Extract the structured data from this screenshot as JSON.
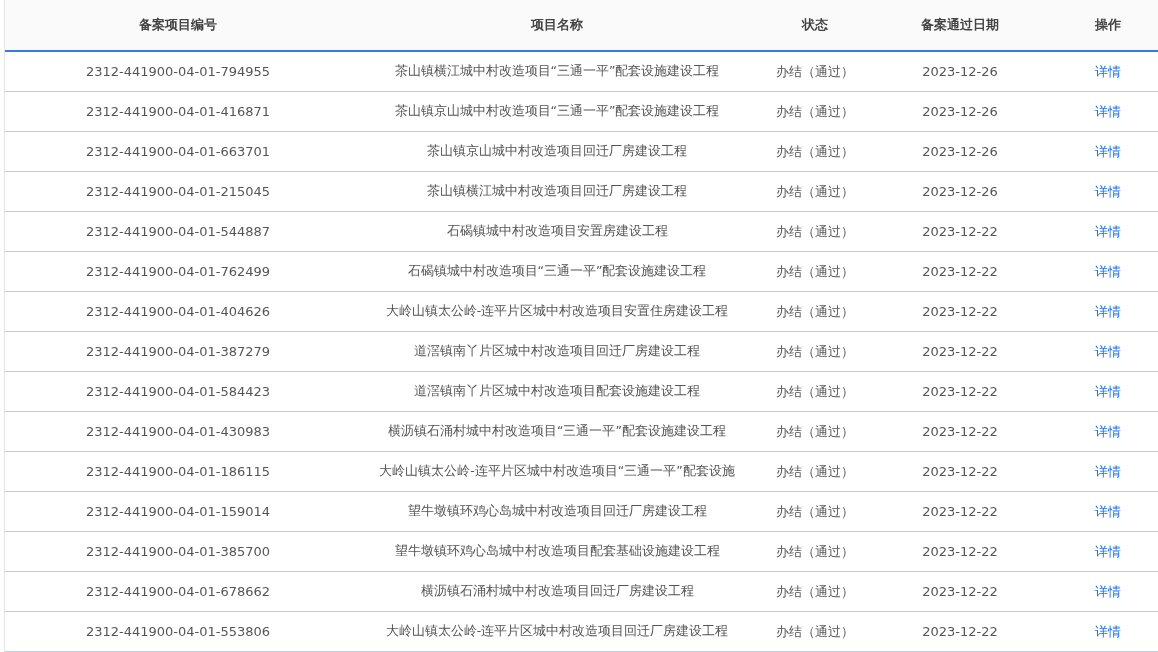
{
  "table": {
    "columns": [
      "备案项目编号",
      "项目名称",
      "状态",
      "备案通过日期",
      "操作"
    ],
    "rows": [
      {
        "code": "2312-441900-04-01-794955",
        "name": "茶山镇横江城中村改造项目“三通一平”配套设施建设工程",
        "status": "办结（通过）",
        "date": "2023-12-26",
        "action": "详情"
      },
      {
        "code": "2312-441900-04-01-416871",
        "name": "茶山镇京山城中村改造项目“三通一平”配套设施建设工程",
        "status": "办结（通过）",
        "date": "2023-12-26",
        "action": "详情"
      },
      {
        "code": "2312-441900-04-01-663701",
        "name": "茶山镇京山城中村改造项目回迁厂房建设工程",
        "status": "办结（通过）",
        "date": "2023-12-26",
        "action": "详情"
      },
      {
        "code": "2312-441900-04-01-215045",
        "name": "茶山镇横江城中村改造项目回迁厂房建设工程",
        "status": "办结（通过）",
        "date": "2023-12-26",
        "action": "详情"
      },
      {
        "code": "2312-441900-04-01-544887",
        "name": "石碣镇城中村改造项目安置房建设工程",
        "status": "办结（通过）",
        "date": "2023-12-22",
        "action": "详情"
      },
      {
        "code": "2312-441900-04-01-762499",
        "name": "石碣镇城中村改造项目“三通一平”配套设施建设工程",
        "status": "办结（通过）",
        "date": "2023-12-22",
        "action": "详情"
      },
      {
        "code": "2312-441900-04-01-404626",
        "name": "大岭山镇太公岭-连平片区城中村改造项目安置住房建设工程",
        "status": "办结（通过）",
        "date": "2023-12-22",
        "action": "详情"
      },
      {
        "code": "2312-441900-04-01-387279",
        "name": "道滘镇南丫片区城中村改造项目回迁厂房建设工程",
        "status": "办结（通过）",
        "date": "2023-12-22",
        "action": "详情"
      },
      {
        "code": "2312-441900-04-01-584423",
        "name": "道滘镇南丫片区城中村改造项目配套设施建设工程",
        "status": "办结（通过）",
        "date": "2023-12-22",
        "action": "详情"
      },
      {
        "code": "2312-441900-04-01-430983",
        "name": "横沥镇石涌村城中村改造项目“三通一平”配套设施建设工程",
        "status": "办结（通过）",
        "date": "2023-12-22",
        "action": "详情"
      },
      {
        "code": "2312-441900-04-01-186115",
        "name": "大岭山镇太公岭-连平片区城中村改造项目“三通一平”配套设施",
        "status": "办结（通过）",
        "date": "2023-12-22",
        "action": "详情"
      },
      {
        "code": "2312-441900-04-01-159014",
        "name": "望牛墩镇环鸡心岛城中村改造项目回迁厂房建设工程",
        "status": "办结（通过）",
        "date": "2023-12-22",
        "action": "详情"
      },
      {
        "code": "2312-441900-04-01-385700",
        "name": "望牛墩镇环鸡心岛城中村改造项目配套基础设施建设工程",
        "status": "办结（通过）",
        "date": "2023-12-22",
        "action": "详情"
      },
      {
        "code": "2312-441900-04-01-678662",
        "name": "横沥镇石涌村城中村改造项目回迁厂房建设工程",
        "status": "办结（通过）",
        "date": "2023-12-22",
        "action": "详情"
      },
      {
        "code": "2312-441900-04-01-553806",
        "name": "大岭山镇太公岭-连平片区城中村改造项目回迁厂房建设工程",
        "status": "办结（通过）",
        "date": "2023-12-22",
        "action": "详情"
      }
    ]
  }
}
